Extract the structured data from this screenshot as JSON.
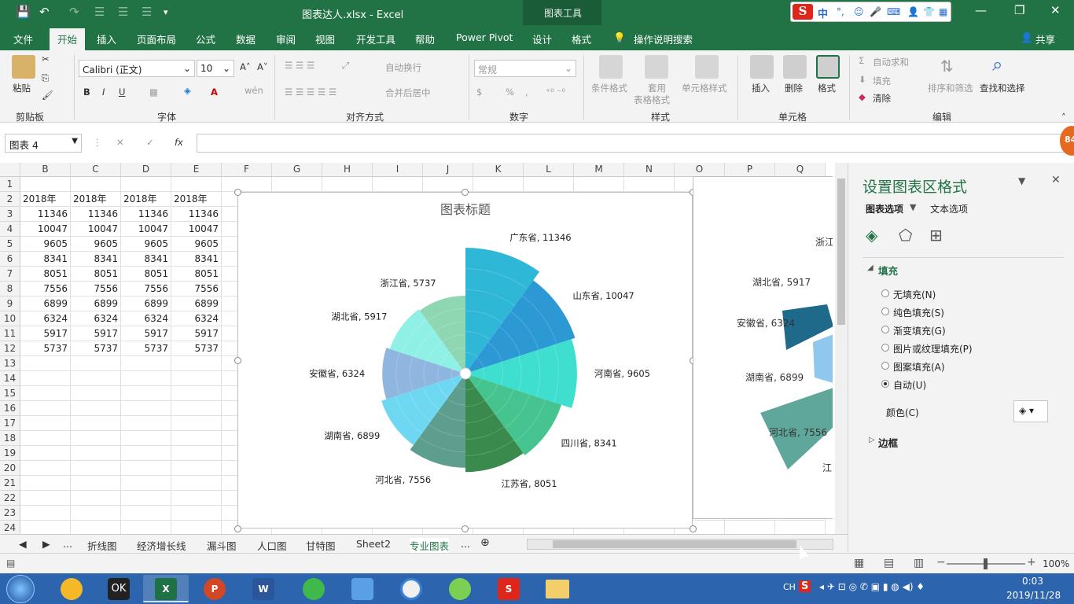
{
  "window": {
    "title": "图表达人.xlsx  -  Excel",
    "context_group": "图表工具"
  },
  "ime": {
    "brand": "S",
    "lang": "中"
  },
  "tabs": [
    "文件",
    "开始",
    "插入",
    "页面布局",
    "公式",
    "数据",
    "审阅",
    "视图",
    "开发工具",
    "帮助",
    "Power Pivot",
    "设计",
    "格式"
  ],
  "tell_me": "操作说明搜索",
  "share": "共享",
  "ribbon": {
    "clipboard": {
      "paste": "粘贴",
      "label": "剪贴板"
    },
    "font": {
      "name": "Calibri (正文)",
      "size": "10",
      "label": "字体",
      "bold": "B",
      "italic": "I",
      "underline": "U"
    },
    "align": {
      "wrap": "自动换行",
      "merge": "合并后居中",
      "label": "对齐方式"
    },
    "number": {
      "format": "常规",
      "percent": "%",
      "comma": ",",
      "label": "数字"
    },
    "styles": {
      "cond": "条件格式",
      "table1": "套用",
      "table2": "表格格式",
      "cell": "单元格样式",
      "label": "样式"
    },
    "cells": {
      "insert": "插入",
      "delete": "删除",
      "format": "格式",
      "label": "单元格"
    },
    "editing": {
      "autosum": "自动求和",
      "fill": "填充",
      "clear": "清除",
      "sort": "排序和筛选",
      "find": "查找和选择",
      "label": "编辑"
    }
  },
  "formula_bar": {
    "name_box": "图表 4",
    "fx": "fx",
    "cancel": "✕",
    "enter": "✓",
    "value": ""
  },
  "columns": [
    "B",
    "C",
    "D",
    "E",
    "F",
    "G",
    "H",
    "I",
    "J",
    "K",
    "L",
    "M",
    "N",
    "O",
    "P",
    "Q"
  ],
  "rows": [
    "1",
    "2",
    "3",
    "4",
    "5",
    "6",
    "7",
    "8",
    "9",
    "10",
    "11",
    "12",
    "13",
    "14",
    "15",
    "16",
    "17",
    "18",
    "19",
    "20",
    "21",
    "22",
    "23",
    "24"
  ],
  "sheet": {
    "header_row": [
      "2018年",
      "2018年",
      "2018年",
      "2018年"
    ],
    "values": [
      11346,
      10047,
      9605,
      8341,
      8051,
      7556,
      6899,
      6324,
      5917,
      5737
    ]
  },
  "chart_data": {
    "type": "rose",
    "title": "图表标题",
    "categories": [
      "广东省",
      "山东省",
      "河南省",
      "四川省",
      "江苏省",
      "河北省",
      "湖南省",
      "安徽省",
      "湖北省",
      "浙江省"
    ],
    "values": [
      11346,
      10047,
      9605,
      8341,
      8051,
      7556,
      6899,
      6324,
      5917,
      5737
    ],
    "data_labels": [
      "广东省, 11346",
      "山东省, 10047",
      "河南省, 9605",
      "四川省, 8341",
      "江苏省, 8051",
      "河北省, 7556",
      "湖南省, 6899",
      "安徽省, 6324",
      "湖北省, 5917",
      "浙江省, 5737"
    ],
    "colors": [
      "#2fb7d8",
      "#2c98d4",
      "#3fdfd0",
      "#45c48f",
      "#3a8a4e",
      "#5d9e8e",
      "#6ed8f2",
      "#8fb6df",
      "#8ff0e6",
      "#8fd6b3"
    ]
  },
  "chart2_labels": [
    "浙江",
    "湖北省, 5917",
    "安徽省, 6324",
    "湖南省, 6899",
    "河北省, 7556",
    "江"
  ],
  "sheet_tabs": [
    "...",
    "折线图",
    "经济增长线",
    "漏斗图",
    "人口图",
    "甘特图",
    "Sheet2",
    "专业图表",
    "..."
  ],
  "pane": {
    "title": "设置图表区格式",
    "tab_chart_options": "图表选项",
    "tab_text_options": "文本选项",
    "section_fill": "填充",
    "fill_options": [
      "无填充(N)",
      "纯色填充(S)",
      "渐变填充(G)",
      "图片或纹理填充(P)",
      "图案填充(A)",
      "自动(U)"
    ],
    "selected_fill": "自动(U)",
    "color_label": "颜色(C)",
    "section_border": "边框"
  },
  "status": {
    "zoom": "100%",
    "zoom_minus": "−",
    "zoom_plus": "+"
  },
  "taskbar": {
    "time": "0:03",
    "date": "2019/11/28",
    "lang": "CH"
  },
  "badge": "84"
}
